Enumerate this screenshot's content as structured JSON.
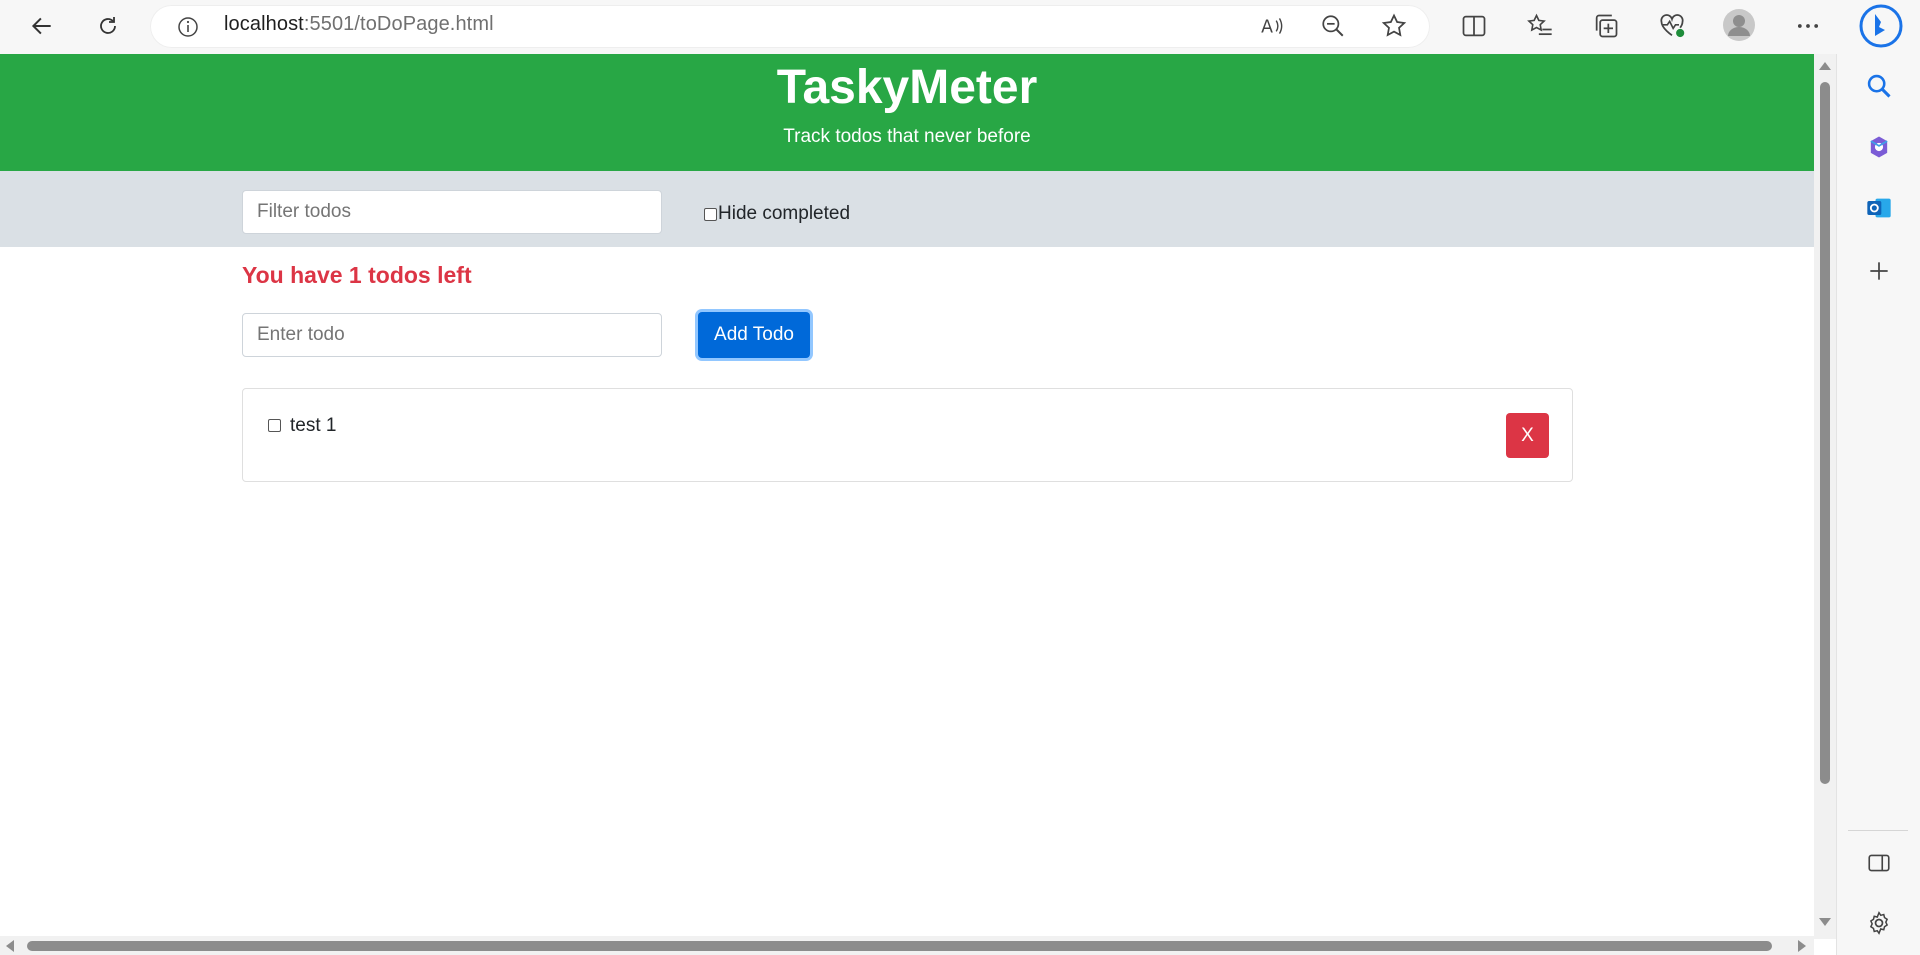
{
  "browser": {
    "url_host": "localhost",
    "url_rest": ":5501/toDoPage.html"
  },
  "app": {
    "title": "TaskyMeter",
    "tagline": "Track todos that never before"
  },
  "filter": {
    "placeholder": "Filter todos",
    "hide_completed_label": "Hide completed"
  },
  "summary": "You have 1 todos left",
  "add_form": {
    "placeholder": "Enter todo",
    "button_label": "Add Todo"
  },
  "todos": [
    {
      "text": "test 1",
      "completed": false,
      "delete_label": "X"
    }
  ],
  "colors": {
    "header": "#28a745",
    "filter_bar": "#dae0e5",
    "danger": "#dc3545",
    "primary": "#0069d9"
  }
}
